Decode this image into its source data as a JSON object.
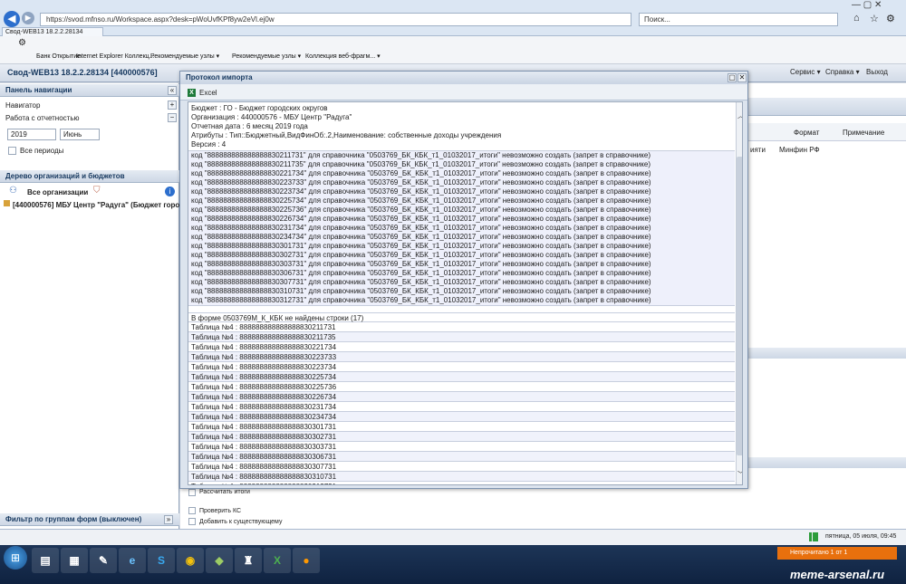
{
  "browser": {
    "address": "https://svod.mfnso.ru/Workspace.aspx?desk=pWoUvfKPf8yw2eVl.ej0w",
    "search_placeholder": "Поиск...",
    "tab_title": "Свод-WEB13 18.2.2.28134",
    "favorites": [
      "Банк Открытие",
      "Internet Explorer Коллекц...",
      "Рекомендуемые узлы ▾",
      "Рекомендуемые узлы ▾",
      "Коллекция веб-фрагм... ▾"
    ]
  },
  "app": {
    "title": "Свод-WEB13 18.2.2.28134 [440000576]",
    "menu": [
      "Сервис ▾",
      "Справка ▾",
      "Выход"
    ]
  },
  "left_panel": {
    "header": "Панель навигации",
    "navigator": "Навигатор",
    "report_mode": "Работа с отчетностью",
    "year": "2019",
    "month": "Июнь",
    "all_periods": "Все периоды",
    "tree_header": "Дерево организаций и бюджетов",
    "all_orgs": "Все организации",
    "org_item": "[440000576] МБУ Центр \"Радуга\" (Бюджет горо",
    "filter_header": "Фильтр по группам форм (выключен)"
  },
  "right_grid": {
    "columns": [
      "Формат",
      "Примечание"
    ],
    "cell_partial": "ияти",
    "cell_format": "Минфин РФ",
    "calc_totals": "Рассчитать итоги",
    "check_ks": "Проверить КС",
    "add_existing": "Добавить к существующему"
  },
  "dialog": {
    "title": "Протокол импорта",
    "excel_label": "Excel",
    "info_lines": [
      "Бюджет : ГО - Бюджет городских округов",
      "Организация : 440000576 - МБУ Центр \"Радуга\"",
      "Отчетная дата : 6 месяц 2019 года",
      "Атрибуты : Тип::Бюджетный,ВидФинОб:.2,Наименование: собственные доходы учреждения",
      "Версия : 4"
    ],
    "error_lines": [
      "код \"888888888888888830211731\" для справочника \"0503769_БК_КБК_т1_01032017_итоги\" невозможно создать (запрет в справочнике)",
      "код \"888888888888888830211735\" для справочника \"0503769_БК_КБК_т1_01032017_итоги\" невозможно создать (запрет в справочнике)",
      "код \"888888888888888830221734\" для справочника \"0503769_БК_КБК_т1_01032017_итоги\" невозможно создать (запрет в справочнике)",
      "код \"888888888888888830223733\" для справочника \"0503769_БК_КБК_т1_01032017_итоги\" невозможно создать (запрет в справочнике)",
      "код \"888888888888888830223734\" для справочника \"0503769_БК_КБК_т1_01032017_итоги\" невозможно создать (запрет в справочнике)",
      "код \"888888888888888830225734\" для справочника \"0503769_БК_КБК_т1_01032017_итоги\" невозможно создать (запрет в справочнике)",
      "код \"888888888888888830225736\" для справочника \"0503769_БК_КБК_т1_01032017_итоги\" невозможно создать (запрет в справочнике)",
      "код \"888888888888888830226734\" для справочника \"0503769_БК_КБК_т1_01032017_итоги\" невозможно создать (запрет в справочнике)",
      "код \"888888888888888830231734\" для справочника \"0503769_БК_КБК_т1_01032017_итоги\" невозможно создать (запрет в справочнике)",
      "код \"888888888888888830234734\" для справочника \"0503769_БК_КБК_т1_01032017_итоги\" невозможно создать (запрет в справочнике)",
      "код \"888888888888888830301731\" для справочника \"0503769_БК_КБК_т1_01032017_итоги\" невозможно создать (запрет в справочнике)",
      "код \"888888888888888830302731\" для справочника \"0503769_БК_КБК_т1_01032017_итоги\" невозможно создать (запрет в справочнике)",
      "код \"888888888888888830303731\" для справочника \"0503769_БК_КБК_т1_01032017_итоги\" невозможно создать (запрет в справочнике)",
      "код \"888888888888888830306731\" для справочника \"0503769_БК_КБК_т1_01032017_итоги\" невозможно создать (запрет в справочнике)",
      "код \"888888888888888830307731\" для справочника \"0503769_БК_КБК_т1_01032017_итоги\" невозможно создать (запрет в справочнике)",
      "код \"888888888888888830310731\" для справочника \"0503769_БК_КБК_т1_01032017_итоги\" невозможно создать (запрет в справочнике)",
      "код \"888888888888888830312731\" для справочника \"0503769_БК_КБК_т1_01032017_итоги\" невозможно создать (запрет в справочнике)"
    ],
    "missing_header": "В форме 0503769М_К_КБК не найдены строки (17)",
    "table_rows": [
      "Таблица №4 : 888888888888888830211731",
      "Таблица №4 : 888888888888888830211735",
      "Таблица №4 : 888888888888888830221734",
      "Таблица №4 : 888888888888888830223733",
      "Таблица №4 : 888888888888888830223734",
      "Таблица №4 : 888888888888888830225734",
      "Таблица №4 : 888888888888888830225736",
      "Таблица №4 : 888888888888888830226734",
      "Таблица №4 : 888888888888888830231734",
      "Таблица №4 : 888888888888888830234734",
      "Таблица №4 : 888888888888888830301731",
      "Таблица №4 : 888888888888888830302731",
      "Таблица №4 : 888888888888888830303731",
      "Таблица №4 : 888888888888888830306731",
      "Таблица №4 : 888888888888888830307731",
      "Таблица №4 : 888888888888888830310731",
      "Таблица №4 : 888888888888888830312731"
    ]
  },
  "statusbar": {
    "datetime": "пятница, 05 июля, 09:45"
  },
  "notification": {
    "text": "Непрочитано 1 от 1"
  },
  "watermark": "meme-arsenal.ru"
}
